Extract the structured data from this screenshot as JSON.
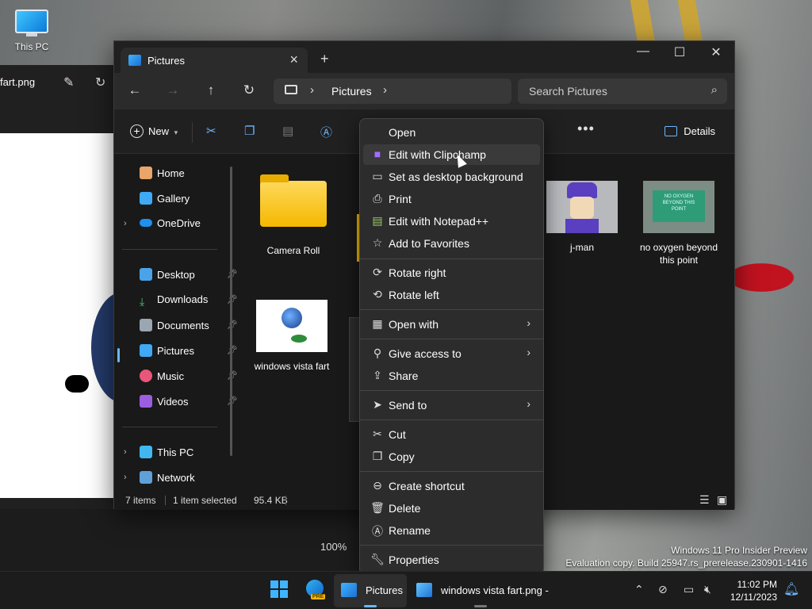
{
  "desktop": {
    "icon_label": "This PC",
    "watermark_line1": "Windows 11 Pro Insider Preview",
    "watermark_line2": "Evaluation copy. Build 25947.rs_prerelease.230901-1416"
  },
  "photos_app": {
    "title": "fart.png",
    "zoom": "100%"
  },
  "explorer": {
    "tab_title": "Pictures",
    "breadcrumb": "Pictures",
    "search_placeholder": "Search Pictures",
    "new_label": "New",
    "details_label": "Details",
    "more_label": "•••",
    "sidebar": {
      "home": "Home",
      "gallery": "Gallery",
      "onedrive": "OneDrive",
      "desktop": "Desktop",
      "downloads": "Downloads",
      "documents": "Documents",
      "pictures": "Pictures",
      "music": "Music",
      "videos": "Videos",
      "this_pc": "This PC",
      "network": "Network"
    },
    "files": {
      "camera_roll": "Camera Roll",
      "jman": "j-man",
      "no_oxygen": "no oxygen beyond this point",
      "vista_fart": "windows vista fart",
      "thumb_text": "NO OXYGEN BEYOND THIS POINT"
    },
    "status": {
      "items": "7 items",
      "selection": "1 item selected",
      "size": "95.4 KB"
    }
  },
  "context_menu": {
    "open": "Open",
    "edit_clipchamp": "Edit with Clipchamp",
    "set_background": "Set as desktop background",
    "print": "Print",
    "edit_notepad": "Edit with Notepad++",
    "add_favorites": "Add to Favorites",
    "rotate_right": "Rotate right",
    "rotate_left": "Rotate left",
    "open_with": "Open with",
    "give_access": "Give access to",
    "share": "Share",
    "send_to": "Send to",
    "cut": "Cut",
    "copy": "Copy",
    "create_shortcut": "Create shortcut",
    "delete": "Delete",
    "rename": "Rename",
    "properties": "Properties"
  },
  "taskbar": {
    "explorer_label": "Pictures",
    "photos_label": "windows vista fart.png -",
    "time": "11:02 PM",
    "date": "12/11/2023",
    "pre_badge": "PRE"
  },
  "colors": {
    "accent": "#6cb6ff",
    "menu_bg": "#2c2c2c",
    "window_bg": "#191919"
  }
}
